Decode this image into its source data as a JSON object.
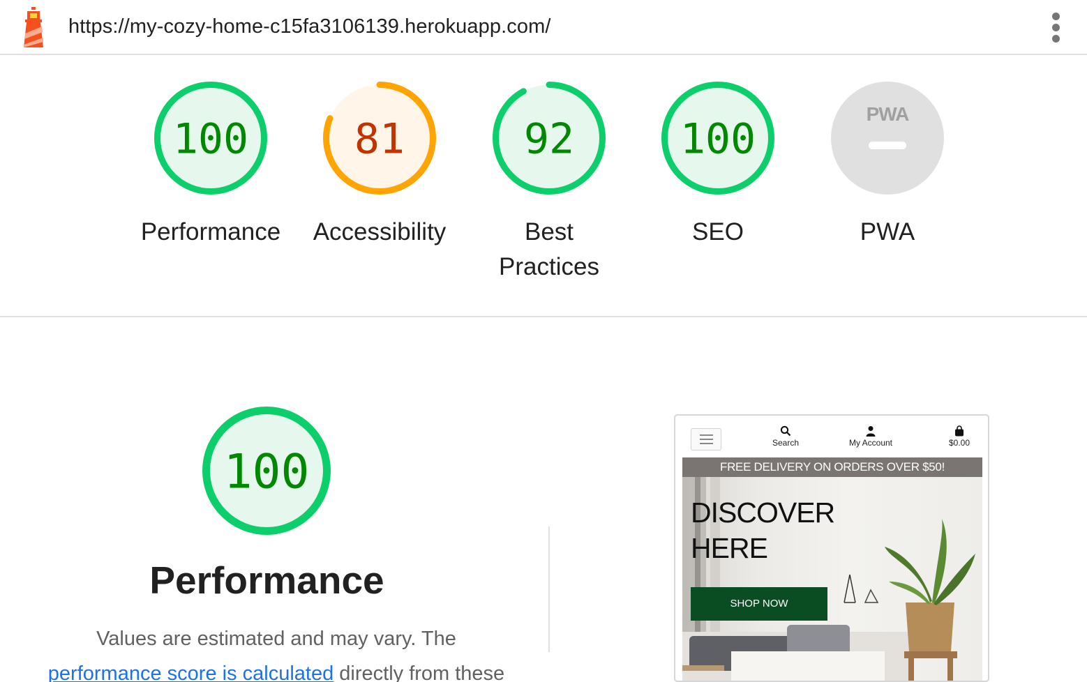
{
  "header": {
    "url": "https://my-cozy-home-c15fa3106139.herokuapp.com/",
    "logo_icon": "lighthouse-icon",
    "menu_icon": "more-vert-icon"
  },
  "categories": [
    {
      "label": "Performance",
      "score": "100",
      "value": 100,
      "status": "pass"
    },
    {
      "label": "Accessibility",
      "score": "81",
      "value": 81,
      "status": "average"
    },
    {
      "label": "Best Practices",
      "score": "92",
      "value": 92,
      "status": "pass"
    },
    {
      "label": "SEO",
      "score": "100",
      "value": 100,
      "status": "pass"
    },
    {
      "label": "PWA",
      "score": "PWA",
      "value": null,
      "status": "na"
    }
  ],
  "colors": {
    "pass": "#0cce6b",
    "pass_fill": "#e6f8ee",
    "pass_text": "#008800",
    "average": "#ffa400",
    "average_fill": "#fff5e9",
    "average_text": "#c33300",
    "na": "#e0e0e0",
    "na_text": "#a0a0a0"
  },
  "performance": {
    "score": "100",
    "title": "Performance",
    "desc_lead": "Values are estimated and may vary. The",
    "desc_link": "performance score is calculated",
    "desc_tail": " directly from these"
  },
  "thumbnail": {
    "nav_search": "Search",
    "nav_account": "My Account",
    "nav_cart": "$0.00",
    "banner": "FREE DELIVERY ON ORDERS OVER $50!",
    "hero_line1": "DISCOVER",
    "hero_line2": "HERE",
    "cta": "SHOP NOW"
  }
}
